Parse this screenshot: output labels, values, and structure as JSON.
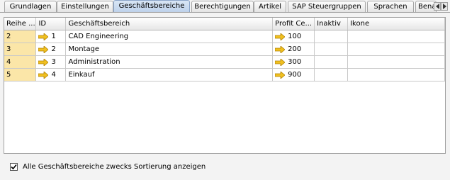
{
  "tabs": [
    {
      "label": "Grundlagen"
    },
    {
      "label": "Einstellungen"
    },
    {
      "label": "Geschäftsbereiche"
    },
    {
      "label": "Berechtigungen"
    },
    {
      "label": "Artikel"
    },
    {
      "label": "SAP Steuergruppen"
    },
    {
      "label": "Sprachen"
    },
    {
      "label": "Bena"
    }
  ],
  "active_tab": "Geschäftsbereiche",
  "table": {
    "headers": [
      "Reihe ...",
      "ID",
      "Geschäftsbereich",
      "Profit Ce...",
      "Inaktiv",
      "Ikone"
    ],
    "rows": [
      {
        "reihe": "2",
        "id": "1",
        "name": "CAD Engineering",
        "profit": "100",
        "inaktiv": "",
        "ikone": ""
      },
      {
        "reihe": "3",
        "id": "2",
        "name": "Montage",
        "profit": "200",
        "inaktiv": "",
        "ikone": ""
      },
      {
        "reihe": "4",
        "id": "3",
        "name": "Administration",
        "profit": "300",
        "inaktiv": "",
        "ikone": ""
      },
      {
        "reihe": "5",
        "id": "4",
        "name": "Einkauf",
        "profit": "900",
        "inaktiv": "",
        "ikone": ""
      }
    ]
  },
  "show_all_checkbox": {
    "label": "Alle Geschäftsbereiche zwecks Sortierung anzeigen",
    "checked": true
  },
  "colors": {
    "accent": "#bcd0ea",
    "row_highlight": "#fbe6a8",
    "arrow": "#f0c020"
  },
  "icons": {
    "link_arrow": "link-arrow-icon",
    "scroll_left": "scroll-left-icon",
    "scroll_right": "scroll-right-icon",
    "check": "checkmark-icon"
  }
}
